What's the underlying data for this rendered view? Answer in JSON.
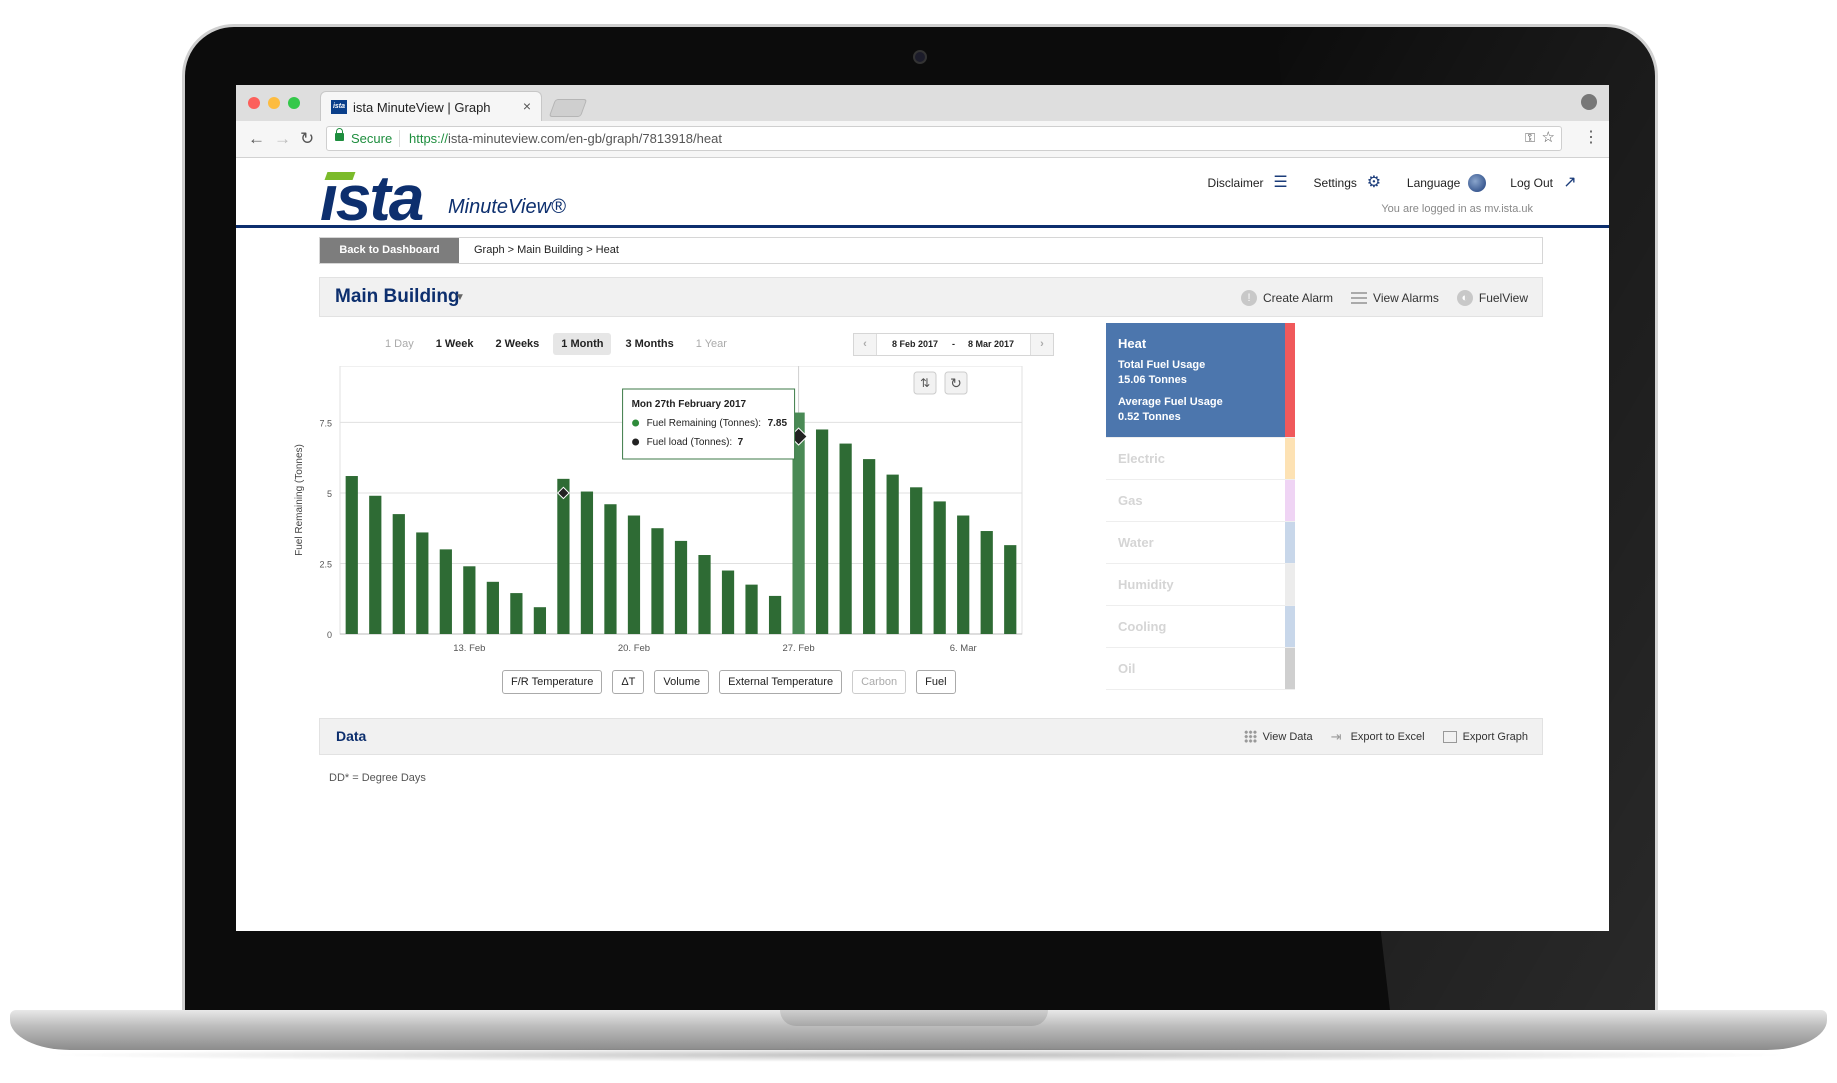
{
  "browser": {
    "tab_title": "ista MinuteView | Graph",
    "tab_favicon": "ista",
    "tab_close": "×",
    "secure_label": "Secure",
    "url_proto": "https://",
    "url_rest": "ista-minuteview.com/en-gb/graph/7813918/heat"
  },
  "header": {
    "logo": "ista",
    "logo_sub": "MinuteView®",
    "nav": [
      {
        "label": "Disclaimer",
        "icon": "list-icon"
      },
      {
        "label": "Settings",
        "icon": "sliders-icon"
      },
      {
        "label": "Language",
        "icon": "globe-icon"
      },
      {
        "label": "Log Out",
        "icon": "external-link-icon"
      }
    ],
    "logged_in": "You are logged in as mv.ista.uk"
  },
  "breadcrumb": {
    "back_label": "Back to Dashboard",
    "path": "Graph > Main Building > Heat"
  },
  "title_bar": {
    "building": "Main Building",
    "actions": [
      {
        "label": "Create Alarm",
        "icon": "alarm-icon"
      },
      {
        "label": "View Alarms",
        "icon": "bars-icon"
      },
      {
        "label": "FuelView",
        "icon": "gauge-icon"
      }
    ]
  },
  "ranges": [
    {
      "label": "1 Day",
      "state": "dim"
    },
    {
      "label": "1 Week",
      "state": "normal"
    },
    {
      "label": "2 Weeks",
      "state": "normal"
    },
    {
      "label": "1 Month",
      "state": "active"
    },
    {
      "label": "3 Months",
      "state": "normal"
    },
    {
      "label": "1 Year",
      "state": "dim"
    }
  ],
  "date_range": {
    "from": "8 Feb 2017",
    "dash": "-",
    "to": "8 Mar 2017"
  },
  "chart_data": {
    "type": "bar",
    "ylabel": "Fuel Remaining (Tonnes)",
    "ylim": [
      0,
      9.5
    ],
    "yticks": [
      0,
      2.5,
      5,
      7.5
    ],
    "ytick_labels": [
      "0",
      "2.5",
      "5",
      "7.5"
    ],
    "x_day_offsets_label": [
      "13. Feb",
      "20. Feb",
      "27. Feb",
      "6. Mar"
    ],
    "x_tick_dates": [
      "2017-02-13",
      "2017-02-20",
      "2017-02-27",
      "2017-03-06"
    ],
    "x": [
      "2017-02-08",
      "2017-02-09",
      "2017-02-10",
      "2017-02-11",
      "2017-02-12",
      "2017-02-13",
      "2017-02-14",
      "2017-02-15",
      "2017-02-16",
      "2017-02-17",
      "2017-02-18",
      "2017-02-19",
      "2017-02-20",
      "2017-02-21",
      "2017-02-22",
      "2017-02-23",
      "2017-02-24",
      "2017-02-25",
      "2017-02-26",
      "2017-02-27",
      "2017-02-28",
      "2017-03-01",
      "2017-03-02",
      "2017-03-03",
      "2017-03-04",
      "2017-03-05",
      "2017-03-06",
      "2017-03-07"
    ],
    "series": [
      {
        "name": "Fuel Remaining (Tonnes)",
        "color": "#2e6b34",
        "values": [
          5.6,
          4.9,
          4.25,
          3.6,
          3.0,
          2.4,
          1.85,
          1.45,
          0.95,
          5.5,
          5.05,
          4.6,
          4.2,
          3.75,
          3.3,
          2.8,
          2.25,
          1.75,
          1.35,
          7.85,
          7.25,
          6.75,
          6.2,
          5.65,
          5.2,
          4.7,
          4.2,
          3.65,
          3.15
        ]
      },
      {
        "name": "Fuel load (Tonnes)",
        "color": "#222222",
        "points": [
          {
            "x": "2017-02-17",
            "y": 5
          },
          {
            "x": "2017-02-27",
            "y": 7
          }
        ]
      }
    ],
    "highlight_index": 19,
    "tooltip": {
      "title": "Mon 27th February 2017",
      "rows": [
        {
          "label": "Fuel Remaining (Tonnes): ",
          "value": "7.85",
          "color": "#2e8b3a"
        },
        {
          "label": "Fuel load (Tonnes): ",
          "value": "7",
          "color": "#222222"
        }
      ]
    },
    "grid": true
  },
  "filters": [
    {
      "label": "F/R Temperature",
      "state": "normal"
    },
    {
      "label": "ΔT",
      "state": "normal"
    },
    {
      "label": "Volume",
      "state": "normal"
    },
    {
      "label": "External Temperature",
      "state": "normal"
    },
    {
      "label": "Carbon",
      "state": "dim"
    },
    {
      "label": "Fuel",
      "state": "normal"
    }
  ],
  "utilities": {
    "heat": {
      "label": "Heat",
      "total_label": "Total Fuel Usage",
      "total_value": "15.06 Tonnes",
      "avg_label": "Average Fuel Usage",
      "avg_value": "0.52 Tonnes",
      "stripe": "#f0595b"
    },
    "others": [
      {
        "label": "Electric",
        "stripe": "#fde2b4"
      },
      {
        "label": "Gas",
        "stripe": "#efd4f4"
      },
      {
        "label": "Water",
        "stripe": "#c8d7ea"
      },
      {
        "label": "Humidity",
        "stripe": "#ececec"
      },
      {
        "label": "Cooling",
        "stripe": "#c8d7ea"
      },
      {
        "label": "Oil",
        "stripe": "#cfcfcf"
      }
    ]
  },
  "data_bar": {
    "title": "Data",
    "actions": [
      {
        "label": "View Data",
        "icon": "grid-icon"
      },
      {
        "label": "Export to Excel",
        "icon": "export-arrow-icon"
      },
      {
        "label": "Export Graph",
        "icon": "chart-export-icon"
      }
    ]
  },
  "footnote": "DD* = Degree Days"
}
